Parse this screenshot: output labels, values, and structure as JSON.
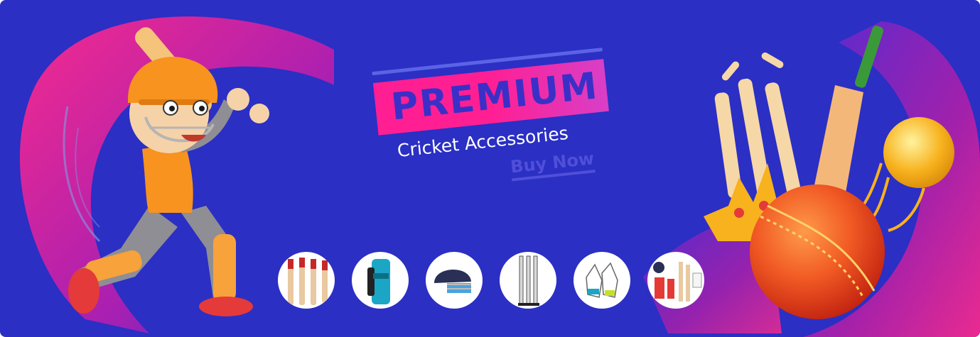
{
  "banner": {
    "premium_label": "PREMIUM",
    "subtitle": "Cricket Accessories",
    "cta_label": "Buy Now"
  },
  "thumbnails": [
    {
      "name": "cricket-bats-thumbnail"
    },
    {
      "name": "kit-bag-thumbnail"
    },
    {
      "name": "helmet-thumbnail"
    },
    {
      "name": "stumps-thumbnail"
    },
    {
      "name": "gloves-thumbnail"
    },
    {
      "name": "full-kit-thumbnail"
    }
  ],
  "colors": {
    "background": "#2b2fc4",
    "premium_box": "#ff1f93",
    "premium_text": "#3a30c7",
    "cta_text": "#4f4fd8"
  }
}
